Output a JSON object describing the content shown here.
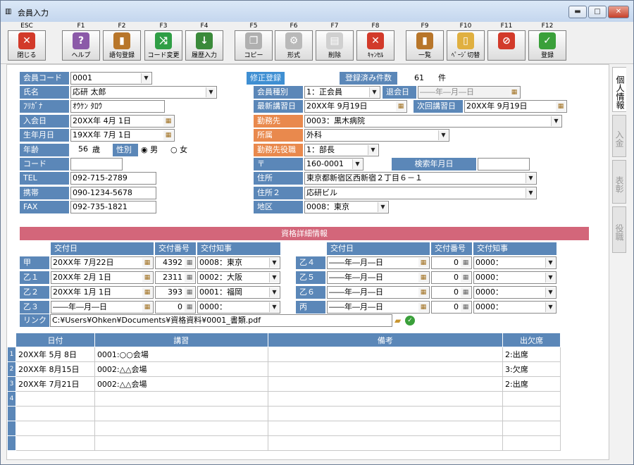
{
  "window": {
    "title": "会員入力",
    "minimize_icon": "minimize-icon",
    "maximize_icon": "maximize-icon",
    "close_icon": "close-icon"
  },
  "toolbar": {
    "keys": [
      {
        "key": "ESC",
        "label": "閉じる",
        "icon": "close-x-icon"
      },
      {
        "key": "F1",
        "label": "ヘルプ",
        "icon": "help-icon"
      },
      {
        "key": "F2",
        "label": "語句登録",
        "icon": "book-icon"
      },
      {
        "key": "F3",
        "label": "コード変更",
        "icon": "shuffle-icon"
      },
      {
        "key": "F4",
        "label": "履歴入力",
        "icon": "download-arrow-icon"
      },
      {
        "key": "F5",
        "label": "コピー",
        "icon": "copy-icon"
      },
      {
        "key": "F6",
        "label": "形式",
        "icon": "gear-icon"
      },
      {
        "key": "F7",
        "label": "削除",
        "icon": "delete-doc-icon"
      },
      {
        "key": "F8",
        "label": "ｷｬﾝｾﾙ",
        "icon": "cancel-icon"
      },
      {
        "key": "F9",
        "label": "一覧",
        "icon": "list-book-icon"
      },
      {
        "key": "F10",
        "label": "ﾍﾟｰｼﾞ切替",
        "icon": "page-switch-icon"
      },
      {
        "key": "F11",
        "label": "",
        "icon": "prohibit-icon"
      },
      {
        "key": "F12",
        "label": "登録",
        "icon": "check-icon"
      }
    ]
  },
  "member": {
    "code_label": "会員コード",
    "code_value": "0001",
    "name_label": "氏名",
    "name_value": "応研 太郎",
    "kana_label": "ﾌﾘｶﾞﾅ",
    "kana_value": "ｵｳｹﾝ ﾀﾛｳ",
    "join_label": "入会日",
    "join_value": "20XX年 4月 1日",
    "birth_label": "生年月日",
    "birth_value": "19XX年 7月 1日",
    "age_label": "年齢",
    "age_value": "56",
    "age_unit": "歳",
    "gender_label": "性別",
    "male": "男",
    "female": "女",
    "code2_label": "コード",
    "code2_value": "",
    "tel_label": "TEL",
    "tel_value": "092-715-2789",
    "mobile_label": "携帯",
    "mobile_value": "090-1234-5678",
    "fax_label": "FAX",
    "fax_value": "092-735-1821"
  },
  "right": {
    "mode_badge": "修正登録",
    "count_label": "登録済み件数",
    "count_value": "61",
    "count_unit": "件",
    "type_label": "会員種別",
    "type_value": "1：正会員",
    "leave_label": "退会日",
    "leave_value": "――年―月―日",
    "latest_label": "最新講習日",
    "latest_value": "20XX年 9月19日",
    "next_label": "次回講習日",
    "next_value": "20XX年 9月19日",
    "work_label": "勤務先",
    "work_value": "0003：黒木病院",
    "dept_label": "所属",
    "dept_value": "外科",
    "role_label": "勤務先役職",
    "role_value": "1：部長",
    "zip_label": "〒",
    "zip_value": "160-0001",
    "search_label": "検索年月日",
    "search_value": "",
    "addr_label": "住所",
    "addr_value": "東京都新宿区西新宿２丁目６－１",
    "addr2_label": "住所２",
    "addr2_value": "応研ビル",
    "area_label": "地区",
    "area_value": "0008：東京"
  },
  "qual": {
    "header": "資格詳細情報",
    "col_date": "交付日",
    "col_num": "交付番号",
    "col_gov": "交付知事",
    "left_rows": [
      {
        "label": "甲",
        "date": "20XX年 7月22日",
        "num": "4392",
        "gov": "0008：東京"
      },
      {
        "label": "乙１",
        "date": "20XX年 2月 1日",
        "num": "2311",
        "gov": "0002：大阪"
      },
      {
        "label": "乙２",
        "date": "20XX年 1月 1日",
        "num": "393",
        "gov": "0001：福岡"
      },
      {
        "label": "乙３",
        "date": "――年―月―日",
        "num": "0",
        "gov": "0000："
      }
    ],
    "right_rows": [
      {
        "label": "乙４",
        "date": "――年―月―日",
        "num": "0",
        "gov": "0000："
      },
      {
        "label": "乙５",
        "date": "――年―月―日",
        "num": "0",
        "gov": "0000："
      },
      {
        "label": "乙６",
        "date": "――年―月―日",
        "num": "0",
        "gov": "0000："
      },
      {
        "label": "丙",
        "date": "――年―月―日",
        "num": "0",
        "gov": "0000："
      }
    ],
    "link_label": "リンク",
    "link_value": "C:¥Users¥Ohken¥Documents¥資格資料¥0001_書類.pdf"
  },
  "history": {
    "headers": [
      "日付",
      "講習",
      "備考",
      "出欠席"
    ],
    "rows": [
      {
        "n": "1",
        "date": "20XX年 5月 8日",
        "course": "0001:○○会場",
        "note": "",
        "att": "2:出席"
      },
      {
        "n": "2",
        "date": "20XX年 8月15日",
        "course": "0002:△△会場",
        "note": "",
        "att": "3:欠席"
      },
      {
        "n": "3",
        "date": "20XX年 7月21日",
        "course": "0002:△△会場",
        "note": "",
        "att": "2:出席"
      },
      {
        "n": "4",
        "date": "",
        "course": "",
        "note": "",
        "att": ""
      },
      {
        "n": "",
        "date": "",
        "course": "",
        "note": "",
        "att": ""
      },
      {
        "n": "",
        "date": "",
        "course": "",
        "note": "",
        "att": ""
      },
      {
        "n": "",
        "date": "",
        "course": "",
        "note": "",
        "att": ""
      }
    ]
  },
  "tabs": [
    "個人情報",
    "入金",
    "表彰",
    "役職"
  ]
}
